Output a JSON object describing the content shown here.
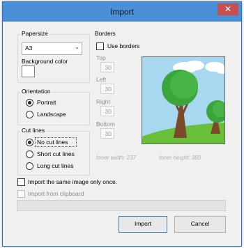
{
  "window": {
    "title": "Import",
    "close_glyph": "✕"
  },
  "papersize": {
    "group_label": "Papersize",
    "selected": "A3",
    "bg_color_label": "Background color"
  },
  "orientation": {
    "group_label": "Orientation",
    "options": [
      "Portrait",
      "Landscape"
    ],
    "selected": "Portrait"
  },
  "cutlines": {
    "group_label": "Cut lines",
    "options": [
      "No cut lines",
      "Short cut lines",
      "Long cut lines"
    ],
    "selected": "No cut lines"
  },
  "borders": {
    "group_label": "Borders",
    "use_borders_label": "Use borders",
    "use_borders_checked": false,
    "fields": [
      {
        "label": "Top",
        "value": "30"
      },
      {
        "label": "Left",
        "value": "30"
      },
      {
        "label": "Right",
        "value": "30"
      },
      {
        "label": "Bottom",
        "value": "30"
      }
    ],
    "inner_width": "Inner width: 237",
    "inner_height": "Inner height: 360"
  },
  "options": {
    "same_image_once": "Import the same image only once.",
    "from_clipboard": "Import from clipboard"
  },
  "buttons": {
    "import": "Import",
    "cancel": "Cancel"
  },
  "colors": {
    "titlebar": "#4a90d9",
    "close": "#c74f4f",
    "sky": "#a8d8f0",
    "grass": "#6abf3a",
    "tree_green": "#3aa53a",
    "trunk": "#7a4a2a"
  }
}
